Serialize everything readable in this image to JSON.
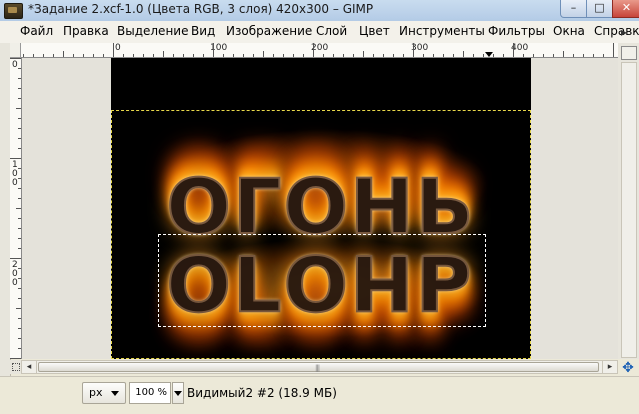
{
  "window": {
    "title": "*Задание 2.xcf-1.0 (Цвета RGB, 3 слоя) 420x300 – GIMP",
    "minimize_glyph": "–",
    "maximize_glyph": "□",
    "close_glyph": "✕"
  },
  "menu": {
    "items": [
      "Файл",
      "Правка",
      "Выделение",
      "Вид",
      "Изображение",
      "Слой",
      "Цвет",
      "Инструменты",
      "Фильтры",
      "Окна",
      "Справк"
    ],
    "overflow_glyph": "▸"
  },
  "ruler_top": {
    "labels": [
      "0",
      "100",
      "200",
      "300",
      "400"
    ]
  },
  "ruler_left": {
    "labels": [
      "0",
      "100",
      "200"
    ]
  },
  "canvas": {
    "text_top": "ОГОНЬ",
    "text_bottom": "ОГОНЬ",
    "background_color": "#000000",
    "flame_colors": [
      "#ffb020",
      "#ff8c00",
      "#e05800"
    ]
  },
  "scrollbar": {
    "left_glyph": "◂",
    "right_glyph": "▸",
    "grip": "|||"
  },
  "status": {
    "unit": "px",
    "zoom": "100 %",
    "layer_info": "Видимый2 #2 (18.9 МБ)"
  },
  "icons": {
    "app": "gimp-icon",
    "navigate": "navigate-icon",
    "quickmask": "quick-mask-icon"
  }
}
